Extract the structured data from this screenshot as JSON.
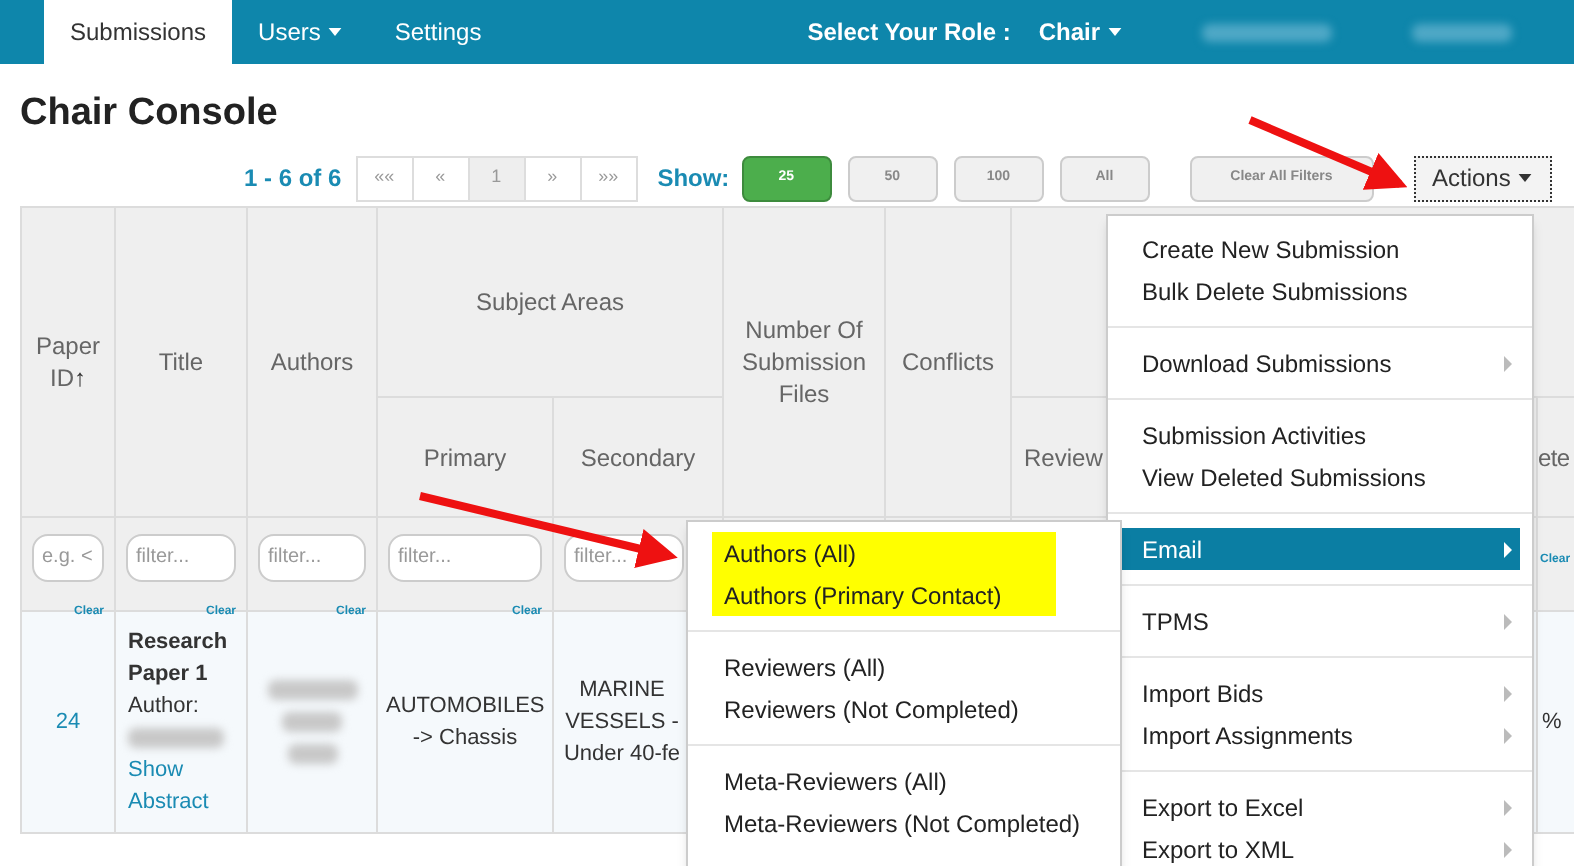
{
  "navbar": {
    "tabs": [
      {
        "label": "Submissions",
        "selected": true,
        "caret": false
      },
      {
        "label": "Users",
        "selected": false,
        "caret": true
      },
      {
        "label": "Settings",
        "selected": false,
        "caret": false
      }
    ],
    "role_label": "Select Your Role :",
    "role": "Chair"
  },
  "page_title": "Chair Console",
  "pagination": {
    "summary": "1 - 6 of 6",
    "pages": [
      {
        "label": "««",
        "selected": false
      },
      {
        "label": "«",
        "selected": false
      },
      {
        "label": "1",
        "selected": true
      },
      {
        "label": "»",
        "selected": false
      },
      {
        "label": "»»",
        "selected": false
      }
    ]
  },
  "show": {
    "label": "Show:",
    "options": [
      {
        "label": "25",
        "selected": true
      },
      {
        "label": "50",
        "selected": false
      },
      {
        "label": "100",
        "selected": false
      },
      {
        "label": "All",
        "selected": false
      }
    ]
  },
  "clear_filters": "Clear All Filters",
  "actions_button": "Actions",
  "table": {
    "group_header": "Subject Areas",
    "columns": [
      {
        "label": "Paper ID",
        "sort": "↑",
        "placeholder": "e.g. <",
        "clear": "Clear"
      },
      {
        "label": "Title",
        "placeholder": "filter...",
        "clear": "Clear"
      },
      {
        "label": "Authors",
        "placeholder": "filter...",
        "clear": "Clear"
      },
      {
        "label": "Primary",
        "placeholder": "filter...",
        "clear": "Clear"
      },
      {
        "label": "Secondary",
        "placeholder": "filter..."
      },
      {
        "label": "Number Of Submission Files"
      },
      {
        "label": "Conflicts"
      },
      {
        "label": "Review"
      },
      {},
      {
        "label": "ete",
        "clear": "Clear"
      }
    ],
    "rows": [
      {
        "paper_id": "24",
        "title": "Research Paper 1",
        "author_label": "Author:",
        "show_abstract": "Show Abstract",
        "primary": "AUTOMOBILES -> Chassis",
        "secondary": [
          "MARINE",
          "VESSELS -",
          "Under 40-fe"
        ],
        "column_10": "%"
      }
    ]
  },
  "actions_menu": [
    {
      "label": "Create New Submission",
      "submenu": false,
      "selected": false,
      "divider_after": false
    },
    {
      "label": "Bulk Delete Submissions",
      "submenu": false,
      "selected": false,
      "divider_after": true
    },
    {
      "label": "Download Submissions",
      "submenu": true,
      "selected": false,
      "divider_after": true
    },
    {
      "label": "Submission Activities",
      "submenu": false,
      "selected": false,
      "divider_after": false
    },
    {
      "label": "View Deleted Submissions",
      "submenu": false,
      "selected": false,
      "divider_after": true
    },
    {
      "label": "Email",
      "submenu": true,
      "selected": true,
      "divider_after": true
    },
    {
      "label": "TPMS",
      "submenu": true,
      "selected": false,
      "divider_after": true
    },
    {
      "label": "Import Bids",
      "submenu": true,
      "selected": false,
      "divider_after": false
    },
    {
      "label": "Import Assignments",
      "submenu": true,
      "selected": false,
      "divider_after": true
    },
    {
      "label": "Export to Excel",
      "submenu": true,
      "selected": false,
      "divider_after": false
    },
    {
      "label": "Export to XML",
      "submenu": true,
      "selected": false,
      "divider_after": false
    }
  ],
  "email_submenu": [
    {
      "label": "Authors (All)",
      "highlighted": true,
      "divider_after": false
    },
    {
      "label": "Authors (Primary Contact)",
      "highlighted": true,
      "divider_after": true
    },
    {
      "label": "Reviewers (All)",
      "highlighted": false,
      "divider_after": false
    },
    {
      "label": "Reviewers (Not Completed)",
      "highlighted": false,
      "divider_after": true
    },
    {
      "label": "Meta-Reviewers (All)",
      "highlighted": false,
      "divider_after": false
    },
    {
      "label": "Meta-Reviewers (Not Completed)",
      "highlighted": false,
      "divider_after": false
    }
  ]
}
